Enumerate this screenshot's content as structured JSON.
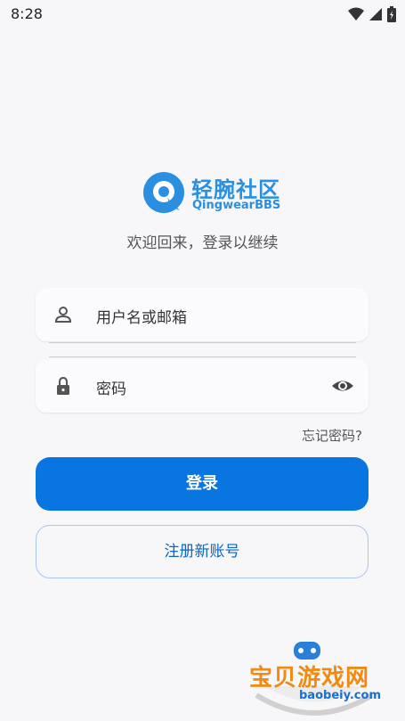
{
  "status_bar": {
    "time": "8:28"
  },
  "brand": {
    "name_cn": "轻腕社区",
    "name_en": "QingwearBBS",
    "color": "#2a8fe0"
  },
  "subtitle": "欢迎回来，登录以继续",
  "form": {
    "username_placeholder": "用户名或邮箱",
    "password_placeholder": "密码",
    "forgot_password": "忘记密码?"
  },
  "buttons": {
    "login": "登录",
    "register": "注册新账号",
    "accent": "#0875e0"
  },
  "watermark": {
    "text": "宝贝游戏网",
    "url": "baobeiy.com"
  },
  "icons": [
    "wifi-icon",
    "signal-icon",
    "battery-icon",
    "user-icon",
    "lock-icon",
    "eye-icon",
    "logo-icon"
  ]
}
